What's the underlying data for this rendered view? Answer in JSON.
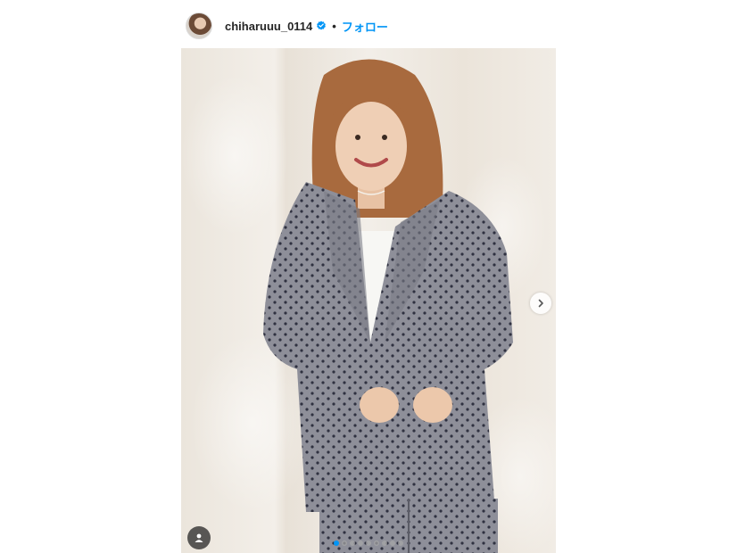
{
  "post": {
    "username": "chiharuuu_0114",
    "separator": "•",
    "follow_label": "フォロー",
    "verified": true
  },
  "carousel": {
    "slide_count": 9,
    "active_index": 0
  },
  "colors": {
    "follow": "#0095f6",
    "verified": "#0095f6",
    "active_dot": "#0095f6",
    "inactive_dot": "#a8a8a8"
  },
  "icons": {
    "verified": "verified-badge-icon",
    "next": "chevron-right-icon",
    "tagged_users": "user-tag-icon"
  }
}
